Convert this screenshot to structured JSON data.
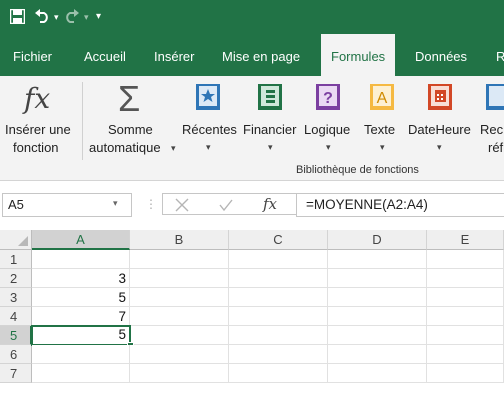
{
  "quick_access": {
    "save_icon": "save-icon",
    "undo_icon": "undo-icon",
    "redo_icon": "redo-icon",
    "customize_icon": "customize-qat-icon"
  },
  "colors": {
    "brand": "#217346",
    "ribbon_bg": "#f3f3f3"
  },
  "tabs": [
    {
      "label": "Fichier"
    },
    {
      "label": "Accueil"
    },
    {
      "label": "Insérer"
    },
    {
      "label": "Mise en page"
    },
    {
      "label": "Formules",
      "active": true
    },
    {
      "label": "Données"
    },
    {
      "label": "R"
    }
  ],
  "ribbon": {
    "insert_function": {
      "line1": "Insérer une",
      "line2": "fonction",
      "icon": "fx-icon"
    },
    "autosum": {
      "line1": "Somme",
      "line2": "automatique",
      "icon": "sigma-icon"
    },
    "recent": {
      "label": "Récentes",
      "icon": "star-book-icon"
    },
    "financial": {
      "label": "Financier",
      "icon": "financial-book-icon"
    },
    "logical": {
      "label": "Logique",
      "icon": "question-book-icon"
    },
    "text": {
      "label": "Texte",
      "icon": "text-book-icon"
    },
    "datetime": {
      "label": "DateHeure",
      "icon": "calendar-book-icon"
    },
    "lookup": {
      "line1": "Rec",
      "line2": "réf",
      "icon": "lookup-book-icon"
    },
    "group_label": "Bibliothèque de fonctions"
  },
  "formula_bar": {
    "name_box": "A5",
    "cancel_icon": "cancel-icon",
    "enter_icon": "check-icon",
    "fx_label": "fx",
    "formula": "=MOYENNE(A2:A4)"
  },
  "sheet": {
    "columns": [
      "A",
      "B",
      "C",
      "D",
      "E"
    ],
    "rows": [
      "1",
      "2",
      "3",
      "4",
      "5",
      "6",
      "7"
    ],
    "cells": {
      "A2": "3",
      "A3": "5",
      "A4": "7",
      "A5": "5"
    },
    "active_cell": "A5"
  }
}
